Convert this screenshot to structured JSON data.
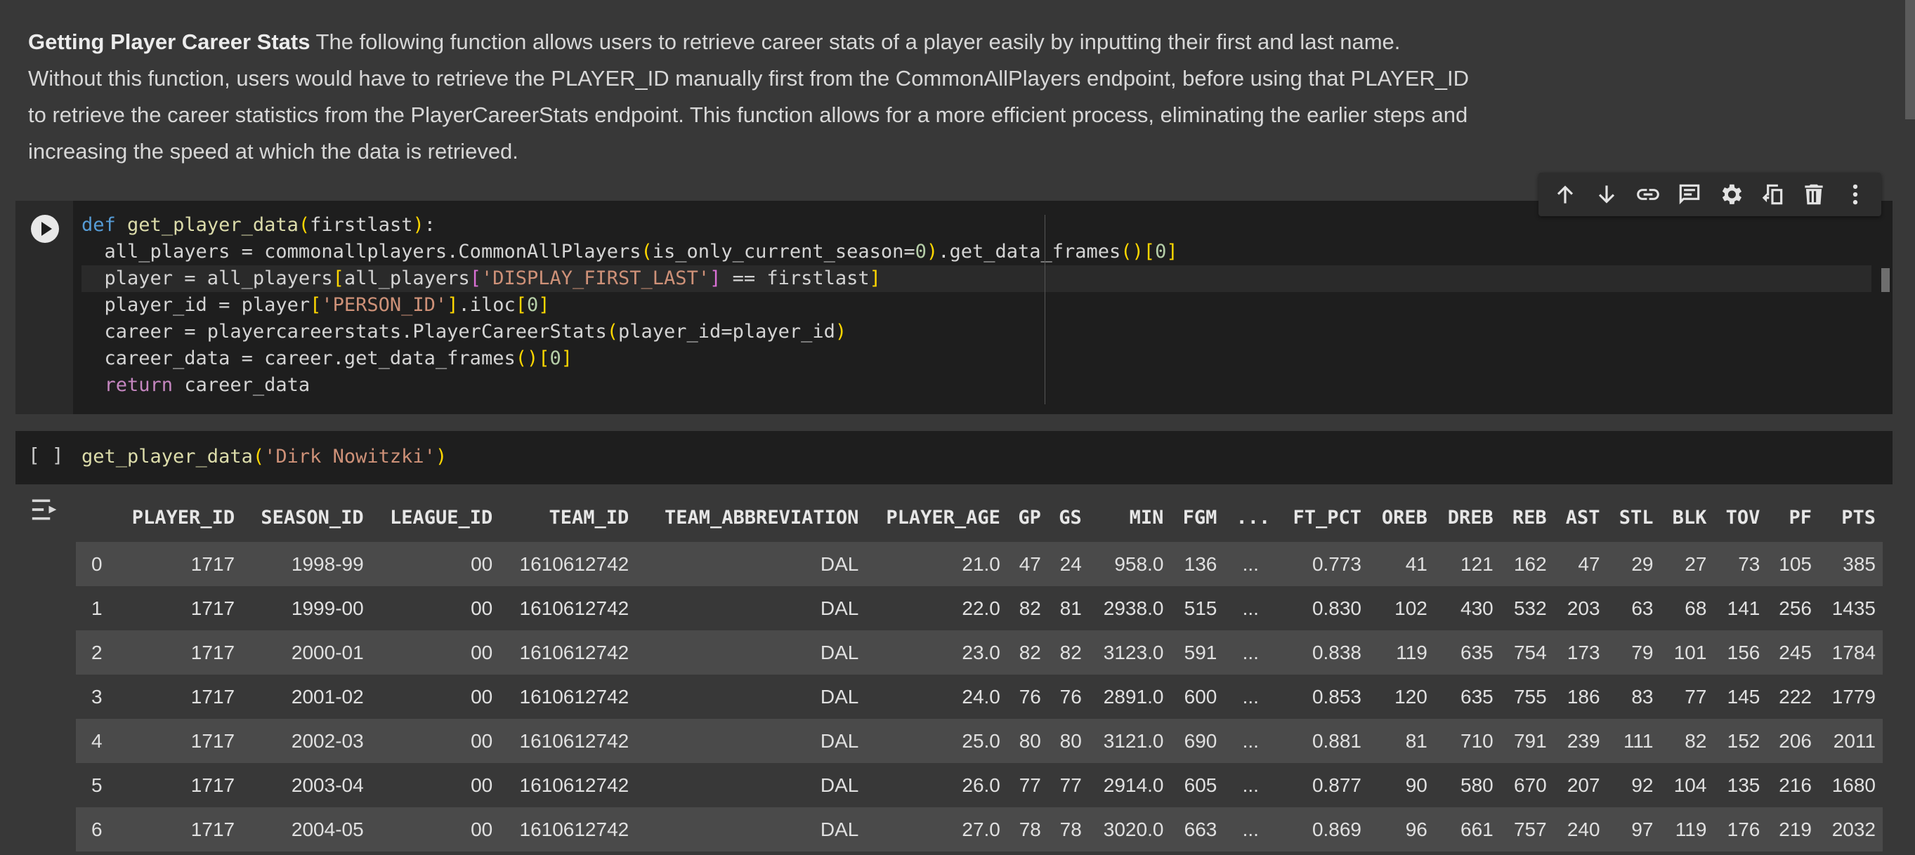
{
  "markdown": {
    "bold_title": "Getting Player Career Stats",
    "text": "The following function allows users to retrieve career stats of a player easily by inputting their first and last name. Without this function, users would have to retrieve the PLAYER_ID manually first from the CommonAllPlayers endpoint, before using that PLAYER_ID to retrieve the career statistics from the PlayerCareerStats endpoint. This function allows for a more efficient process, eliminating the earlier steps and increasing the speed at which the data is retrieved."
  },
  "toolbar": {
    "icons": [
      "arrow-up-icon",
      "arrow-down-icon",
      "link-icon",
      "comment-icon",
      "gear-icon",
      "mirror-cell-icon",
      "delete-icon",
      "more-vert-icon"
    ]
  },
  "cell2": {
    "exec_count": "[ ]",
    "fn_name": "get_player_data",
    "arg": "'Dirk Nowitzki'"
  },
  "table": {
    "columns": [
      "",
      "PLAYER_ID",
      "SEASON_ID",
      "LEAGUE_ID",
      "TEAM_ID",
      "TEAM_ABBREVIATION",
      "PLAYER_AGE",
      "GP",
      "GS",
      "MIN",
      "FGM",
      "...",
      "FT_PCT",
      "OREB",
      "DREB",
      "REB",
      "AST",
      "STL",
      "BLK",
      "TOV",
      "PF",
      "PTS"
    ],
    "rows": [
      [
        "0",
        "1717",
        "1998-99",
        "00",
        "1610612742",
        "DAL",
        "21.0",
        "47",
        "24",
        "958.0",
        "136",
        "...",
        "0.773",
        "41",
        "121",
        "162",
        "47",
        "29",
        "27",
        "73",
        "105",
        "385"
      ],
      [
        "1",
        "1717",
        "1999-00",
        "00",
        "1610612742",
        "DAL",
        "22.0",
        "82",
        "81",
        "2938.0",
        "515",
        "...",
        "0.830",
        "102",
        "430",
        "532",
        "203",
        "63",
        "68",
        "141",
        "256",
        "1435"
      ],
      [
        "2",
        "1717",
        "2000-01",
        "00",
        "1610612742",
        "DAL",
        "23.0",
        "82",
        "82",
        "3123.0",
        "591",
        "...",
        "0.838",
        "119",
        "635",
        "754",
        "173",
        "79",
        "101",
        "156",
        "245",
        "1784"
      ],
      [
        "3",
        "1717",
        "2001-02",
        "00",
        "1610612742",
        "DAL",
        "24.0",
        "76",
        "76",
        "2891.0",
        "600",
        "...",
        "0.853",
        "120",
        "635",
        "755",
        "186",
        "83",
        "77",
        "145",
        "222",
        "1779"
      ],
      [
        "4",
        "1717",
        "2002-03",
        "00",
        "1610612742",
        "DAL",
        "25.0",
        "80",
        "80",
        "3121.0",
        "690",
        "...",
        "0.881",
        "81",
        "710",
        "791",
        "239",
        "111",
        "82",
        "152",
        "206",
        "2011"
      ],
      [
        "5",
        "1717",
        "2003-04",
        "00",
        "1610612742",
        "DAL",
        "26.0",
        "77",
        "77",
        "2914.0",
        "605",
        "...",
        "0.877",
        "90",
        "580",
        "670",
        "207",
        "92",
        "104",
        "135",
        "216",
        "1680"
      ],
      [
        "6",
        "1717",
        "2004-05",
        "00",
        "1610612742",
        "DAL",
        "27.0",
        "78",
        "78",
        "3020.0",
        "663",
        "...",
        "0.869",
        "96",
        "661",
        "757",
        "240",
        "97",
        "119",
        "176",
        "219",
        "2032"
      ]
    ]
  }
}
